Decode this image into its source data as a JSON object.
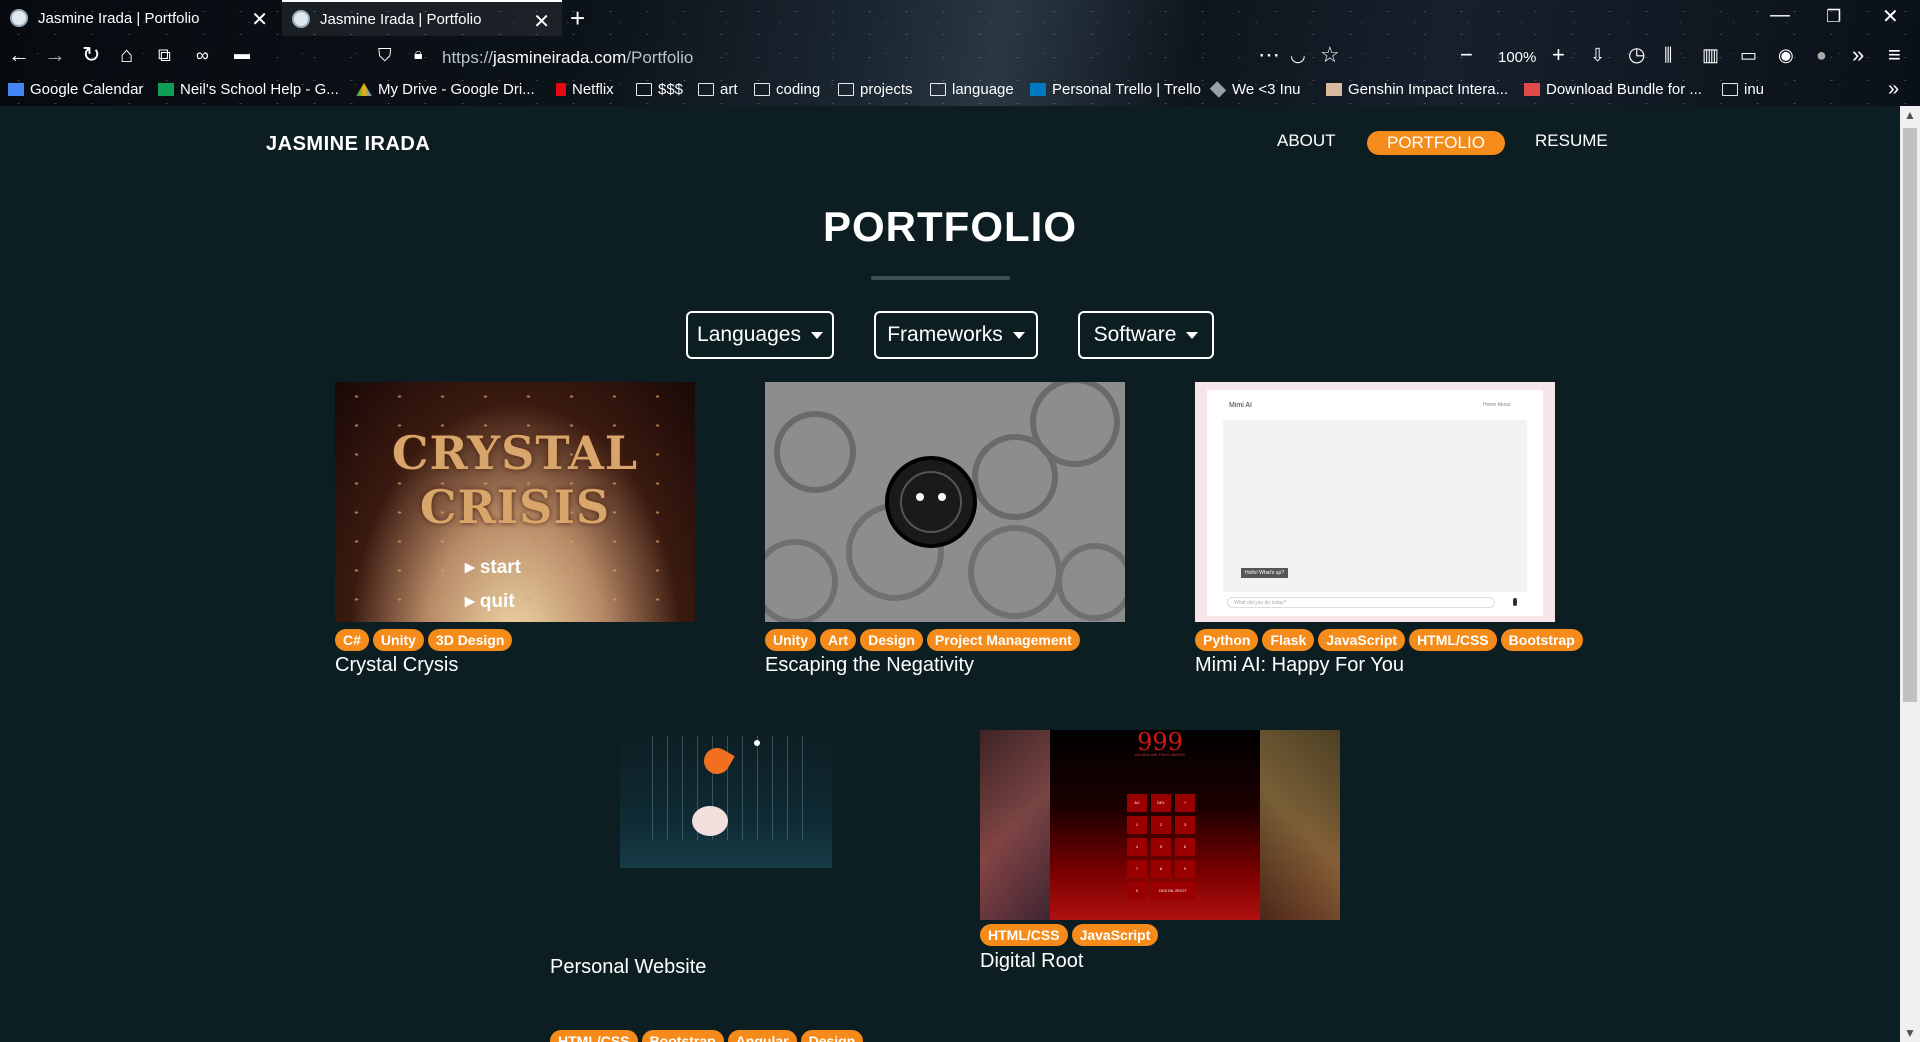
{
  "browser": {
    "tabs": [
      {
        "title": "Jasmine Irada | Portfolio",
        "active": false
      },
      {
        "title": "Jasmine Irada | Portfolio",
        "active": true
      }
    ],
    "url_prefix": "https://",
    "url_host": "jasmineirada.com",
    "url_path": "/Portfolio",
    "zoom": "100%",
    "bookmarks": [
      {
        "label": "Google Calendar",
        "icon": "calendar-icon"
      },
      {
        "label": "Neil's School Help - G...",
        "icon": "sheets-icon"
      },
      {
        "label": "My Drive - Google Dri...",
        "icon": "drive-icon"
      },
      {
        "label": "Netflix",
        "icon": "netflix-icon"
      },
      {
        "label": "$$$",
        "icon": "folder-icon"
      },
      {
        "label": "art",
        "icon": "folder-icon"
      },
      {
        "label": "coding",
        "icon": "folder-icon"
      },
      {
        "label": "projects",
        "icon": "folder-icon"
      },
      {
        "label": "language",
        "icon": "folder-icon"
      },
      {
        "label": "Personal Trello | Trello",
        "icon": "trello-icon"
      },
      {
        "label": "We <3 Inu",
        "icon": "cube-icon"
      },
      {
        "label": "Genshin Impact Intera...",
        "icon": "genshin-icon"
      },
      {
        "label": "Download Bundle for ...",
        "icon": "bundle-icon"
      },
      {
        "label": "inu",
        "icon": "folder-icon"
      }
    ]
  },
  "site": {
    "brand": "JASMINE IRADA",
    "nav": [
      {
        "label": "ABOUT",
        "active": false
      },
      {
        "label": "PORTFOLIO",
        "active": true
      },
      {
        "label": "RESUME",
        "active": false
      }
    ],
    "title": "PORTFOLIO",
    "filters": [
      "Languages",
      "Frameworks",
      "Software"
    ],
    "accent_color": "#f58b1a",
    "background_color": "#0d1e22",
    "projects": [
      {
        "title": "Crystal Crysis",
        "tags": [
          "C#",
          "Unity",
          "3D Design"
        ],
        "thumb_text": "CRYSTAL CRISIS",
        "thumb_menu": [
          "start",
          "quit"
        ]
      },
      {
        "title": "Escaping the Negativity",
        "tags": [
          "Unity",
          "Art",
          "Design",
          "Project Management"
        ]
      },
      {
        "title": "Mimi AI: Happy For You",
        "tags": [
          "Python",
          "Flask",
          "JavaScript",
          "HTML/CSS",
          "Bootstrap"
        ],
        "thumb_text": "Mimi AI",
        "thumb_nav": [
          "Home",
          "About"
        ],
        "thumb_bubble": "Hello! What's up?",
        "thumb_input": "What did you do today?"
      },
      {
        "title": "Personal Website",
        "tags": [
          "HTML/CSS",
          "Bootstrap",
          "Angular",
          "Design"
        ]
      },
      {
        "title": "Digital Root",
        "tags": [
          "HTML/CSS",
          "JavaScript"
        ],
        "thumb_text": "999",
        "thumb_sub": "AN ADD-ME-TOUS-ANGES",
        "thumb_keys": [
          "AC",
          "DEL",
          "+",
          "1",
          "2",
          "3",
          "4",
          "5",
          "6",
          "7",
          "8",
          "9",
          "0",
          "DIGITAL ROOT"
        ]
      }
    ]
  }
}
